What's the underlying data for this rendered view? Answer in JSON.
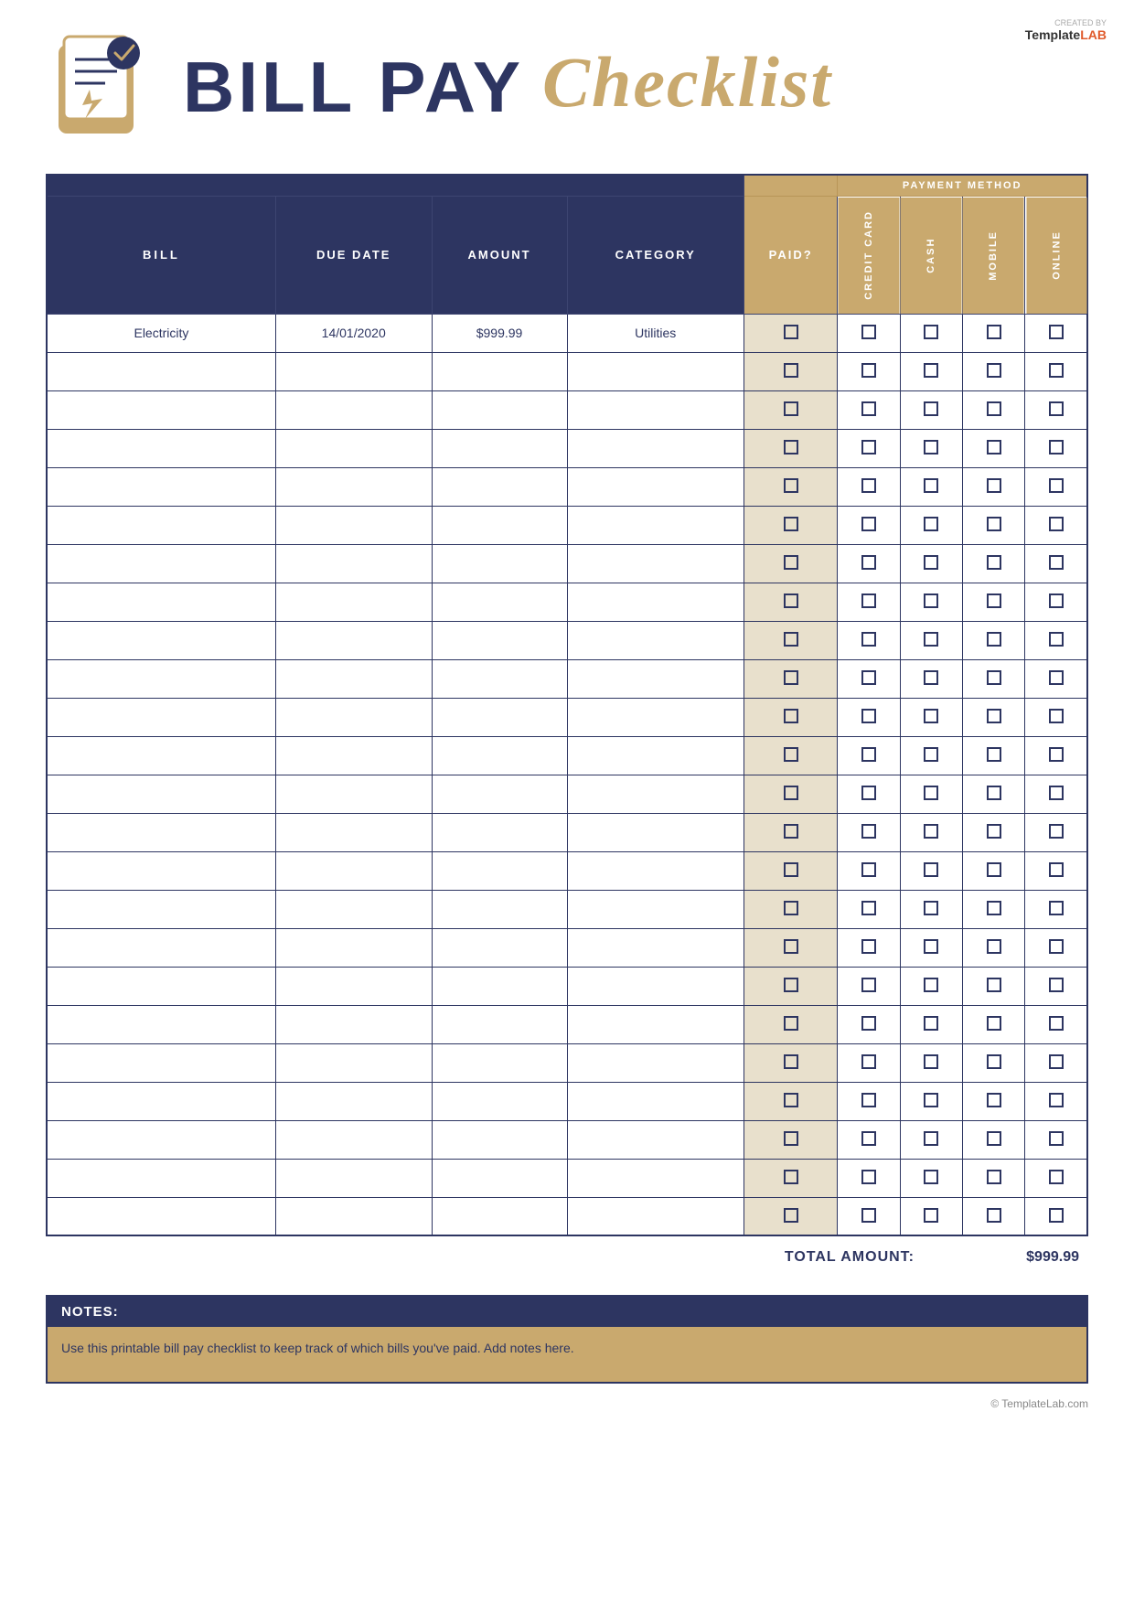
{
  "brand": {
    "created_by": "CREATED BY",
    "name_template": "Template",
    "name_lab": "LAB",
    "website": "© TemplateLab.com"
  },
  "header": {
    "bill_pay": "BILL PAY",
    "checklist": "Checklist"
  },
  "table": {
    "columns": {
      "bill": "BILL",
      "due_date": "DUE DATE",
      "amount": "AMOUNT",
      "category": "CATEGORY",
      "paid": "PAID?",
      "payment_method": "PAYMENT METHOD",
      "credit_card": "CREDIT CARD",
      "cash": "CASH",
      "mobile": "MOBILE",
      "online": "ONLINE"
    },
    "rows": [
      {
        "bill": "Electricity",
        "due_date": "14/01/2020",
        "amount": "$999.99",
        "category": "Utilities"
      },
      {
        "bill": "",
        "due_date": "",
        "amount": "",
        "category": ""
      },
      {
        "bill": "",
        "due_date": "",
        "amount": "",
        "category": ""
      },
      {
        "bill": "",
        "due_date": "",
        "amount": "",
        "category": ""
      },
      {
        "bill": "",
        "due_date": "",
        "amount": "",
        "category": ""
      },
      {
        "bill": "",
        "due_date": "",
        "amount": "",
        "category": ""
      },
      {
        "bill": "",
        "due_date": "",
        "amount": "",
        "category": ""
      },
      {
        "bill": "",
        "due_date": "",
        "amount": "",
        "category": ""
      },
      {
        "bill": "",
        "due_date": "",
        "amount": "",
        "category": ""
      },
      {
        "bill": "",
        "due_date": "",
        "amount": "",
        "category": ""
      },
      {
        "bill": "",
        "due_date": "",
        "amount": "",
        "category": ""
      },
      {
        "bill": "",
        "due_date": "",
        "amount": "",
        "category": ""
      },
      {
        "bill": "",
        "due_date": "",
        "amount": "",
        "category": ""
      },
      {
        "bill": "",
        "due_date": "",
        "amount": "",
        "category": ""
      },
      {
        "bill": "",
        "due_date": "",
        "amount": "",
        "category": ""
      },
      {
        "bill": "",
        "due_date": "",
        "amount": "",
        "category": ""
      },
      {
        "bill": "",
        "due_date": "",
        "amount": "",
        "category": ""
      },
      {
        "bill": "",
        "due_date": "",
        "amount": "",
        "category": ""
      },
      {
        "bill": "",
        "due_date": "",
        "amount": "",
        "category": ""
      },
      {
        "bill": "",
        "due_date": "",
        "amount": "",
        "category": ""
      },
      {
        "bill": "",
        "due_date": "",
        "amount": "",
        "category": ""
      },
      {
        "bill": "",
        "due_date": "",
        "amount": "",
        "category": ""
      },
      {
        "bill": "",
        "due_date": "",
        "amount": "",
        "category": ""
      },
      {
        "bill": "",
        "due_date": "",
        "amount": "",
        "category": ""
      }
    ],
    "total_label": "TOTAL AMOUNT:",
    "total_value": "$999.99"
  },
  "notes": {
    "header": "NOTES:",
    "body": "Use this printable bill pay checklist to keep track of which bills you've paid. Add notes here."
  },
  "colors": {
    "dark_navy": "#2d3561",
    "gold": "#c9a96e",
    "white": "#ffffff",
    "orange": "#e05a2b"
  }
}
